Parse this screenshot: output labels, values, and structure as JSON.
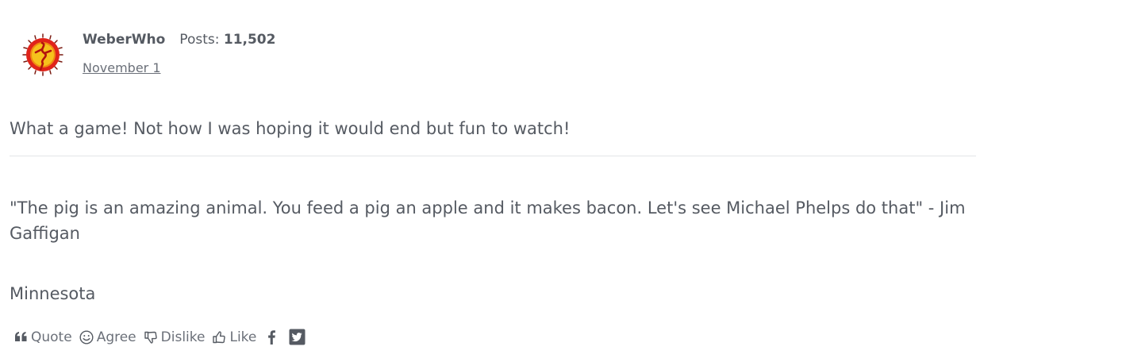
{
  "author": {
    "name": "WeberWho",
    "posts_label": "Posts:",
    "posts_count": "11,502",
    "date": "November 1",
    "avatar_icon": "dancing-figure-avatar-icon"
  },
  "message": {
    "text": "What a game! Not how I was hoping it would end but fun to watch!"
  },
  "signature": {
    "quote": "\"The pig is an amazing animal. You feed a pig an apple and it makes bacon. Let's see Michael Phelps do that\" - Jim Gaffigan",
    "location": "Minnesota"
  },
  "reactions": {
    "quote_label": "Quote",
    "agree_label": "Agree",
    "dislike_label": "Dislike",
    "like_label": "Like",
    "quote_icon": "quote-icon",
    "agree_icon": "smiley-icon",
    "dislike_icon": "thumbs-down-icon",
    "like_icon": "thumbs-up-icon",
    "share_facebook_icon": "facebook-icon",
    "share_twitter_icon": "twitter-icon"
  },
  "colors": {
    "text": "#555a62",
    "muted": "#6b7079",
    "divider": "#e3e5e8",
    "avatar_red": "#e0231a",
    "avatar_yellow": "#f6c21c"
  }
}
